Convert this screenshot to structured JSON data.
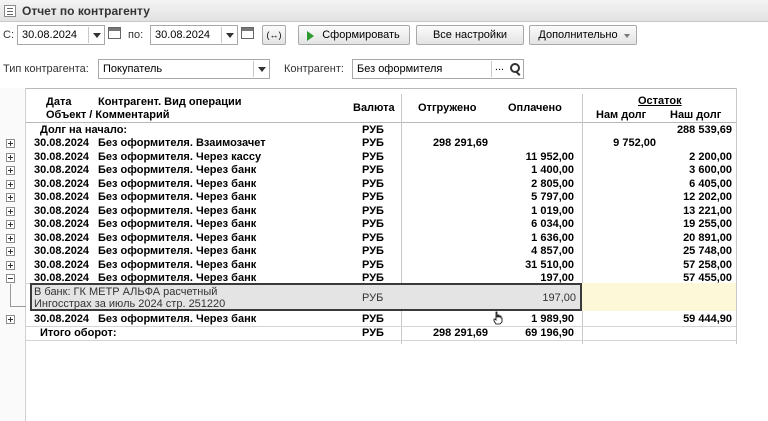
{
  "window": {
    "title": "Отчет по контрагенту"
  },
  "toolbar": {
    "from_label": "С:",
    "from_date": "30.08.2024",
    "to_label": "по:",
    "to_date": "30.08.2024",
    "period_btn": "(↔)",
    "generate_btn": "Сформировать",
    "settings_btn": "Все настройки",
    "more_btn": "Дополнительно"
  },
  "filters": {
    "type_label": "Тип контрагента:",
    "type_value": "Покупатель",
    "counterparty_label": "Контрагент:",
    "counterparty_value": "Без оформителя",
    "ellipsis": "..."
  },
  "table": {
    "headers": {
      "date": "Дата",
      "counterparty": "Контрагент. Вид операции",
      "object": "Объект / Комментарий",
      "currency": "Валюта",
      "shipped": "Отгружено",
      "paid": "Оплачено",
      "balance": "Остаток",
      "we_owed": "Нам долг",
      "our_debt": "Наш долг"
    },
    "opening": {
      "label": "Долг на начало:",
      "currency": "РУБ",
      "our_debt": "288 539,69"
    },
    "rows": [
      {
        "date": "30.08.2024",
        "desc": "Без оформителя. Взаимозачет",
        "currency": "РУБ",
        "shipped": "298 291,69",
        "paid": "",
        "we_owed": "9 752,00",
        "our_debt": ""
      },
      {
        "date": "30.08.2024",
        "desc": "Без оформителя. Через кассу",
        "currency": "РУБ",
        "shipped": "",
        "paid": "11 952,00",
        "we_owed": "",
        "our_debt": "2 200,00"
      },
      {
        "date": "30.08.2024",
        "desc": "Без оформителя. Через банк",
        "currency": "РУБ",
        "shipped": "",
        "paid": "1 400,00",
        "we_owed": "",
        "our_debt": "3 600,00"
      },
      {
        "date": "30.08.2024",
        "desc": "Без оформителя. Через банк",
        "currency": "РУБ",
        "shipped": "",
        "paid": "2 805,00",
        "we_owed": "",
        "our_debt": "6 405,00"
      },
      {
        "date": "30.08.2024",
        "desc": "Без оформителя. Через банк",
        "currency": "РУБ",
        "shipped": "",
        "paid": "5 797,00",
        "we_owed": "",
        "our_debt": "12 202,00"
      },
      {
        "date": "30.08.2024",
        "desc": "Без оформителя. Через банк",
        "currency": "РУБ",
        "shipped": "",
        "paid": "1 019,00",
        "we_owed": "",
        "our_debt": "13 221,00"
      },
      {
        "date": "30.08.2024",
        "desc": "Без оформителя. Через банк",
        "currency": "РУБ",
        "shipped": "",
        "paid": "6 034,00",
        "we_owed": "",
        "our_debt": "19 255,00"
      },
      {
        "date": "30.08.2024",
        "desc": "Без оформителя. Через банк",
        "currency": "РУБ",
        "shipped": "",
        "paid": "1 636,00",
        "we_owed": "",
        "our_debt": "20 891,00"
      },
      {
        "date": "30.08.2024",
        "desc": "Без оформителя. Через банк",
        "currency": "РУБ",
        "shipped": "",
        "paid": "4 857,00",
        "we_owed": "",
        "our_debt": "25 748,00"
      },
      {
        "date": "30.08.2024",
        "desc": "Без оформителя. Через банк",
        "currency": "РУБ",
        "shipped": "",
        "paid": "31 510,00",
        "we_owed": "",
        "our_debt": "57 258,00"
      },
      {
        "date": "30.08.2024",
        "desc": "Без оформителя. Через банк",
        "currency": "РУБ",
        "shipped": "",
        "paid": "197,00",
        "we_owed": "",
        "our_debt": "57 455,00"
      }
    ],
    "detail": {
      "line1": "В банк: ГК МЕТР АЛЬФА расчетный",
      "line2": "Ингосстрах за июль 2024 стр. 251220",
      "currency": "РУБ",
      "paid": "197,00"
    },
    "last_row": {
      "date": "30.08.2024",
      "desc": "Без оформителя. Через банк",
      "currency": "РУБ",
      "shipped": "",
      "paid": "1 989,90",
      "we_owed": "",
      "our_debt": "59 444,90"
    },
    "total": {
      "label": "Итого оборот:",
      "currency": "РУБ",
      "shipped": "298 291,69",
      "paid": "69 196,90"
    }
  }
}
